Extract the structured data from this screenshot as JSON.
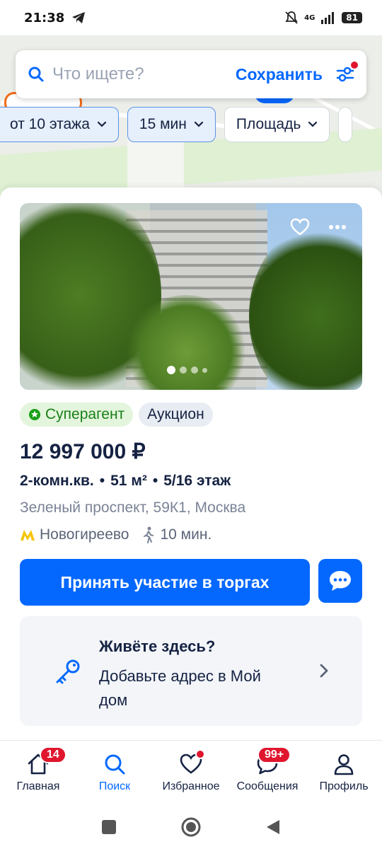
{
  "status_bar": {
    "time": "21:38",
    "network": "4G",
    "battery": "81"
  },
  "search": {
    "placeholder": "Что ищете?",
    "save_label": "Сохранить"
  },
  "filters": [
    {
      "label": "от 10 этажа",
      "active": true
    },
    {
      "label": "15 мин",
      "active": true
    },
    {
      "label": "Площадь",
      "active": false
    }
  ],
  "listing": {
    "photo_dots": 4,
    "badges": {
      "superagent": "Суперагент",
      "auction": "Аукцион"
    },
    "price": "12 997 000 ₽",
    "rooms": "2-комн.кв.",
    "area": "51 м²",
    "floor": "5/16 этаж",
    "separator": "•",
    "address": "Зеленый проспект, 59К1, Москва",
    "metro_station": "Новогиреево",
    "walk_time": "10 мин.",
    "cta_label": "Принять участие в торгах"
  },
  "promo": {
    "title": "Живёте здесь?",
    "subtitle": "Добавьте адрес в Мой дом"
  },
  "bottom_nav": [
    {
      "label": "Главная",
      "badge": "14"
    },
    {
      "label": "Поиск",
      "badge": ""
    },
    {
      "label": "Избранное",
      "badge": ""
    },
    {
      "label": "Сообщения",
      "badge": "99+"
    },
    {
      "label": "Профиль",
      "badge": ""
    }
  ],
  "colors": {
    "accent": "#0468ff",
    "badge_red": "#e0162e",
    "text": "#152242",
    "muted": "#7a8396"
  }
}
